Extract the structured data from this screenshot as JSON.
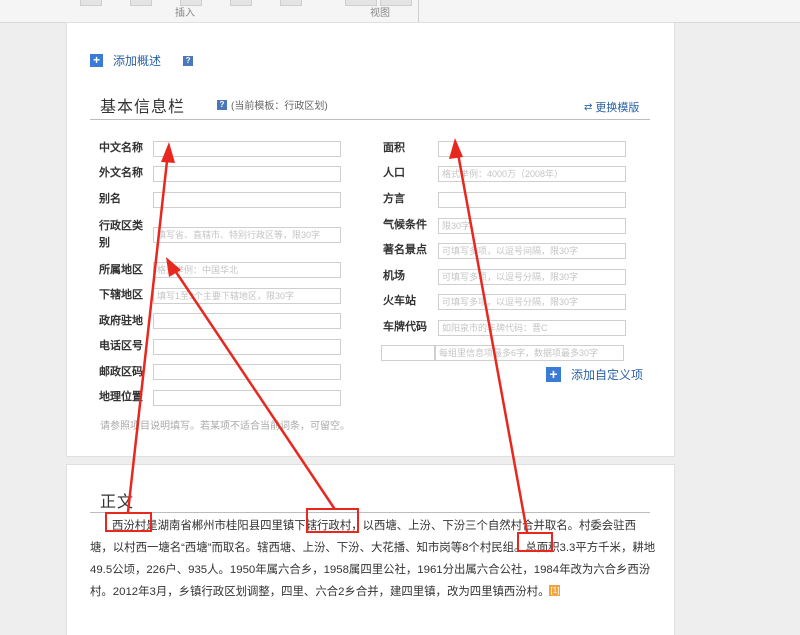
{
  "ribbon": {
    "insert_label": "插入",
    "view_label": "视图"
  },
  "summary": {
    "add_label": "添加概述"
  },
  "infobox": {
    "title": "基本信息栏",
    "template_note": "(当前模板：行政区划)",
    "switch_label": "更换模版",
    "left_fields": [
      {
        "label": "中文名称",
        "placeholder": ""
      },
      {
        "label": "外文名称",
        "placeholder": ""
      },
      {
        "label": "别名",
        "placeholder": ""
      },
      {
        "label_l1": "行政区类",
        "label_l2": "别",
        "placeholder": "填写省、直辖市、特别行政区等，限30字"
      },
      {
        "label": "所属地区",
        "placeholder": "格式举例：中国华北"
      },
      {
        "label": "下辖地区",
        "placeholder": "填写1至3个主要下辖地区，限30字"
      },
      {
        "label": "政府驻地",
        "placeholder": ""
      },
      {
        "label": "电话区号",
        "placeholder": ""
      },
      {
        "label": "邮政区码",
        "placeholder": ""
      },
      {
        "label": "地理位置",
        "placeholder": ""
      }
    ],
    "right_fields": [
      {
        "label": "面积",
        "placeholder": ""
      },
      {
        "label": "人口",
        "placeholder": "格式举例：4000万（2008年）"
      },
      {
        "label": "方言",
        "placeholder": ""
      },
      {
        "label": "气候条件",
        "placeholder": "限30字"
      },
      {
        "label": "著名景点",
        "placeholder": "可填写多项，以逗号间隔，限30字"
      },
      {
        "label": "机场",
        "placeholder": "可填写多项，以逗号分隔，限30字"
      },
      {
        "label": "火车站",
        "placeholder": "可填写多项，以逗号分隔，限30字"
      },
      {
        "label": "车牌代码",
        "placeholder": "如阳泉市的车牌代码：晋C"
      }
    ],
    "custom_value_placeholder": "每组里信息项最多6字，数据项最多30字",
    "add_custom_label": "添加自定义项",
    "tip": "请参照项目说明填写。若某项不适合当前词条，可留空。"
  },
  "body": {
    "title": "正文",
    "line1": "西汾村是湖南省郴州市桂阳县四里镇下辖行政村，以西塘、上汾、下汾三个自然村合并取名。村委会驻西",
    "line2": "塘，以村西一塘名“西塘”而取名。辖西塘、上汾、下汾、大花播、知市岗等8个村民组。总面积3.3平方千米，耕地",
    "line3": "49.5公顷，226户、935人。1950年属六合乡，1958属四里公社，1961分出属六合公社，1984年改为六合乡西汾",
    "line4": "村。2012年3月，乡镇行政区划调整，四里、六合2乡合并，建四里镇，改为四里镇西汾村。",
    "cite": "[1]"
  }
}
